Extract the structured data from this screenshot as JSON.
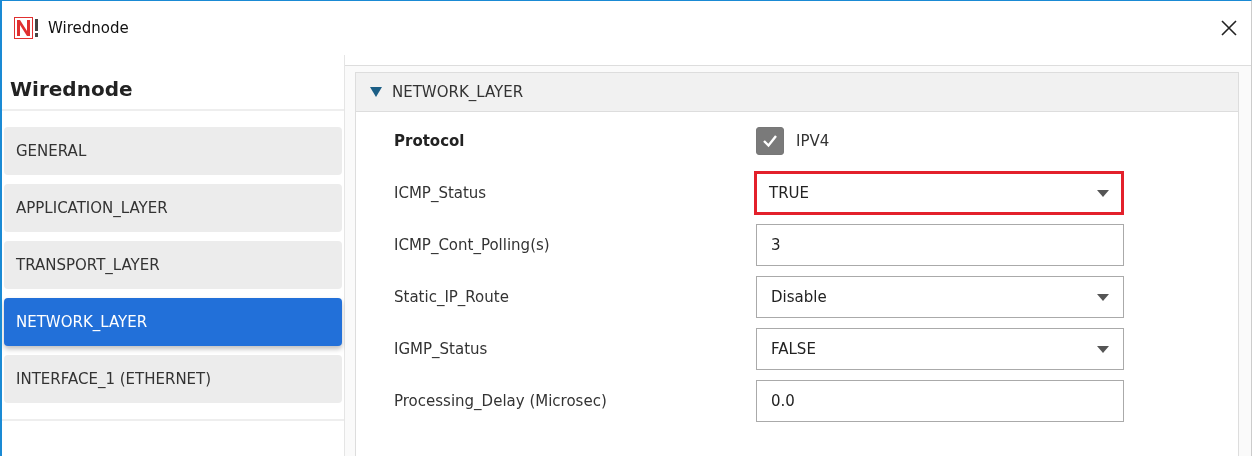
{
  "window": {
    "title": "Wirednode"
  },
  "sidebar": {
    "title": "Wirednode",
    "items": [
      {
        "label": "GENERAL",
        "selected": false
      },
      {
        "label": "APPLICATION_LAYER",
        "selected": false
      },
      {
        "label": "TRANSPORT_LAYER",
        "selected": false
      },
      {
        "label": "NETWORK_LAYER",
        "selected": true
      },
      {
        "label": "INTERFACE_1 (ETHERNET)",
        "selected": false
      }
    ]
  },
  "section": {
    "title": "NETWORK_LAYER",
    "expanded": true,
    "fields": [
      {
        "kind": "checkbox",
        "label": "Protocol",
        "value": "IPV4",
        "checked": true
      },
      {
        "kind": "dropdown",
        "label": "ICMP_Status",
        "value": "TRUE",
        "highlighted": true
      },
      {
        "kind": "text",
        "label": "ICMP_Cont_Polling(s)",
        "value": "3",
        "highlighted": false
      },
      {
        "kind": "dropdown",
        "label": "Static_IP_Route",
        "value": "Disable",
        "highlighted": false
      },
      {
        "kind": "dropdown",
        "label": "IGMP_Status",
        "value": "FALSE",
        "highlighted": false
      },
      {
        "kind": "text",
        "label": "Processing_Delay (Microsec)",
        "value": "0.0",
        "highlighted": false
      }
    ]
  }
}
